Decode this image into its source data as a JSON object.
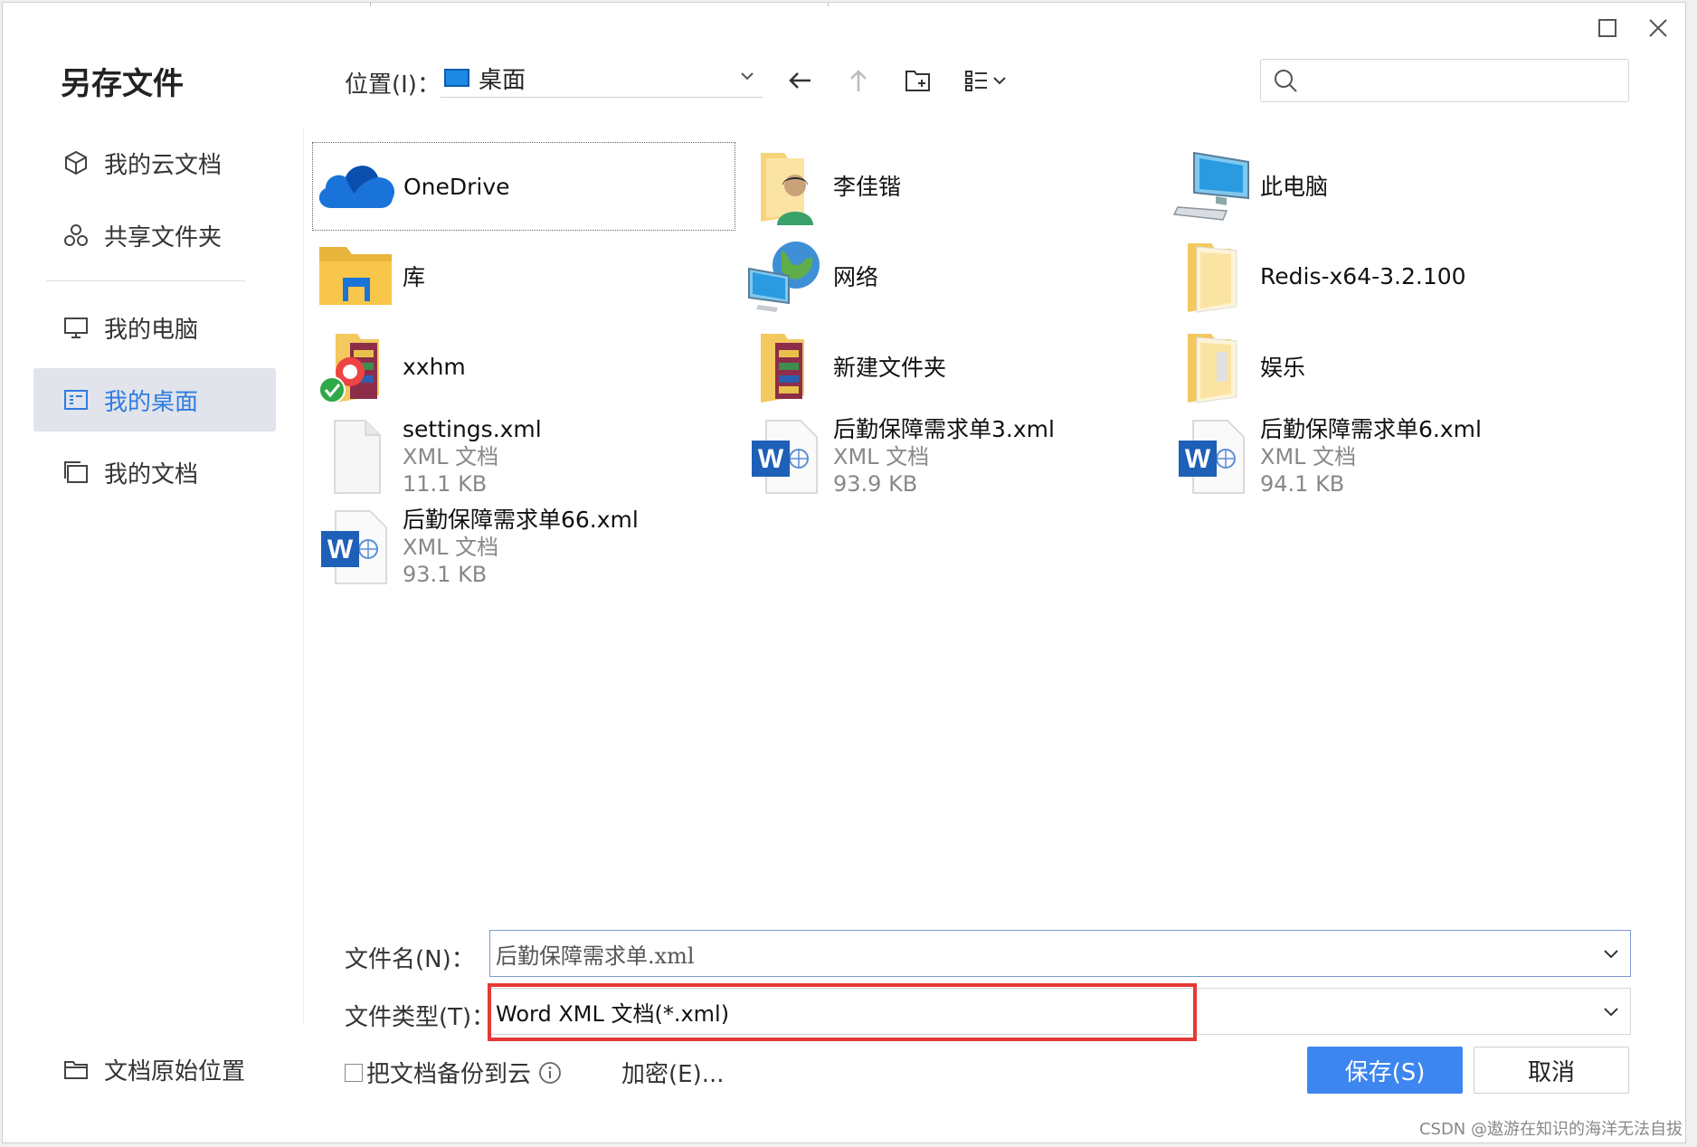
{
  "dialog": {
    "title": "另存文件"
  },
  "sidebar": {
    "items": [
      {
        "label": "我的云文档",
        "icon": "cube-icon"
      },
      {
        "label": "共享文件夹",
        "icon": "share-folder-icon"
      },
      {
        "label": "我的电脑",
        "icon": "monitor-icon"
      },
      {
        "label": "我的桌面",
        "icon": "desktop-icon",
        "active": true
      },
      {
        "label": "我的文档",
        "icon": "documents-icon"
      }
    ],
    "original_location": "文档原始位置"
  },
  "toolbar": {
    "location_label": "位置(I)：",
    "location_value": "桌面",
    "search_value": ""
  },
  "files": [
    {
      "name": "OneDrive",
      "icon": "onedrive-cloud-icon",
      "selected": true
    },
    {
      "name": "李佳锴",
      "icon": "user-folder-icon"
    },
    {
      "name": "此电脑",
      "icon": "computer-icon"
    },
    {
      "name": "库",
      "icon": "library-folder-icon"
    },
    {
      "name": "网络",
      "icon": "network-globe-icon"
    },
    {
      "name": "Redis-x64-3.2.100",
      "icon": "folder-icon"
    },
    {
      "name": "xxhm",
      "icon": "folder-archive-icon"
    },
    {
      "name": "新建文件夹",
      "icon": "folder-archive-icon"
    },
    {
      "name": "娱乐",
      "icon": "folder-icon"
    },
    {
      "name": "settings.xml",
      "type": "XML 文档",
      "size": "11.1 KB",
      "icon": "blank-file-icon"
    },
    {
      "name": "后勤保障需求单3.xml",
      "type": "XML 文档",
      "size": "93.9 KB",
      "icon": "word-xml-icon"
    },
    {
      "name": "后勤保障需求单6.xml",
      "type": "XML 文档",
      "size": "94.1 KB",
      "icon": "word-xml-icon"
    },
    {
      "name": "后勤保障需求单66.xml",
      "type": "XML 文档",
      "size": "93.1 KB",
      "icon": "word-xml-icon"
    }
  ],
  "form": {
    "filename_label": "文件名(N)：",
    "filename_value": "后勤保障需求单.xml",
    "filetype_label": "文件类型(T)：",
    "filetype_value": "Word XML 文档(*.xml)",
    "backup_label": "把文档备份到云",
    "encrypt_label": "加密(E)..."
  },
  "buttons": {
    "save": "保存(S)",
    "cancel": "取消"
  },
  "watermark": "CSDN @遨游在知识的海洋无法自拔",
  "colors": {
    "accent": "#3d86f0",
    "active_text": "#2f7be2",
    "highlight": "#e53935"
  }
}
